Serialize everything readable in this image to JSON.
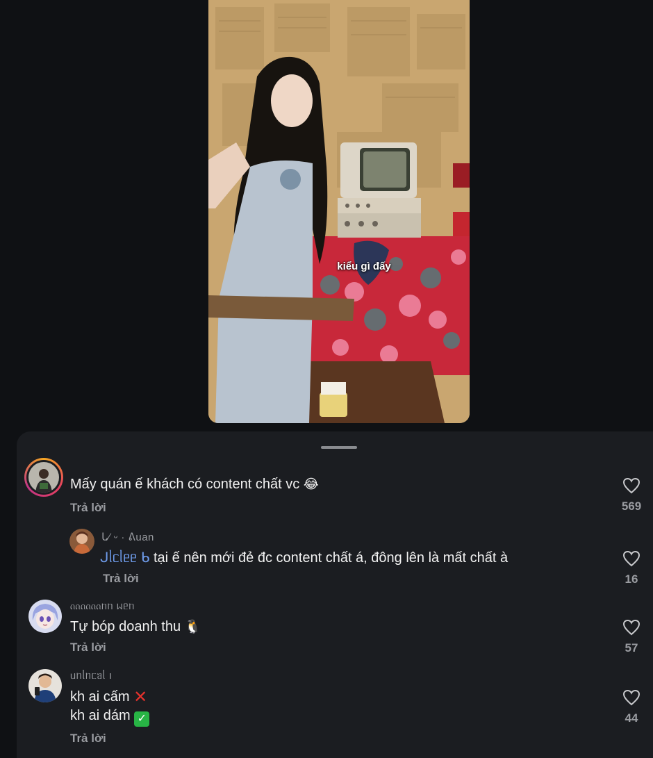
{
  "video": {
    "caption": "kiểu gì đấy"
  },
  "comments": [
    {
      "username": "",
      "text": "Mấy quán ế khách có content chất vc",
      "emoji": "😂",
      "reply_label": "Trả lời",
      "likes": "569",
      "avatar_icon": "person-photo-avatar"
    },
    {
      "username": "ᒐ∕ ᵕ  ·  ᕕuan",
      "mention": "ᒍᥣᥴᥣᥱᥱ ᑲ",
      "text": "tại ế nên mới đẻ đc content chất á, đông lên là mất chất à",
      "reply_label": "Trả lời",
      "likes": "16",
      "avatar_icon": "person-photo-avatar"
    },
    {
      "username": "ᦶᦶᦶᥒᥒ ᥕᥱᥒ",
      "text": "Tự bóp doanh thu",
      "emoji": "🐧",
      "reply_label": "Trả lời",
      "likes": "57",
      "avatar_icon": "anime-character-avatar"
    },
    {
      "username": "ᥙᥒᥣᥒᥴᥑᥣ   ı",
      "text_line1": "kh ai cấm",
      "emoji_line1": "✕",
      "text_line2": "kh ai dám",
      "emoji_line2": "✓",
      "reply_label": "Trả lời",
      "likes": "44",
      "avatar_icon": "person-photo-avatar"
    }
  ],
  "icons": {
    "like": "heart-outline-icon"
  },
  "colors": {
    "background": "#0f1114",
    "sheet": "#1b1d21",
    "mention": "#6e9bea",
    "muted": "#9a9ca1"
  }
}
